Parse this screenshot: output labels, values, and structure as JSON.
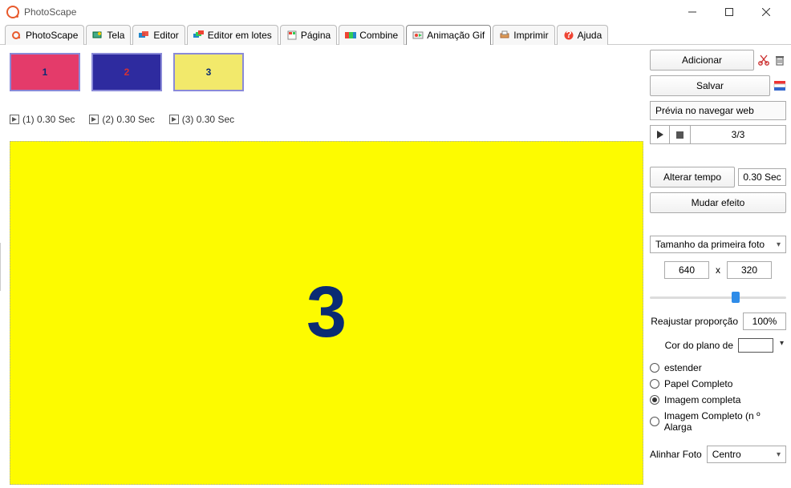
{
  "window": {
    "title": "PhotoScape"
  },
  "tabs": [
    {
      "label": "PhotoScape"
    },
    {
      "label": "Tela"
    },
    {
      "label": "Editor"
    },
    {
      "label": "Editor em lotes"
    },
    {
      "label": "Página"
    },
    {
      "label": "Combine"
    },
    {
      "label": "Animação Gif"
    },
    {
      "label": "Imprimir"
    },
    {
      "label": "Ajuda"
    }
  ],
  "frames": [
    {
      "num": "1",
      "timing": "(1) 0.30 Sec"
    },
    {
      "num": "2",
      "timing": "(2) 0.30 Sec"
    },
    {
      "num": "3",
      "timing": "(3) 0.30 Sec"
    }
  ],
  "preview": {
    "current_number": "3"
  },
  "panel": {
    "add": "Adicionar",
    "save": "Salvar",
    "preview_web": "Prévia no navegar web",
    "frame_counter": "3/3",
    "change_time": "Alterar tempo",
    "time_value": "0.30 Sec",
    "change_effect": "Mudar efeito",
    "size_mode": "Tamanho da primeira foto",
    "width": "640",
    "height": "320",
    "resize_label": "Reajustar proporção",
    "resize_pct": "100%",
    "bgcolor_label": "Cor do plano de",
    "radios": {
      "extend": "estender",
      "full_paper": "Papel Completo",
      "full_image": "Imagem completa",
      "full_image_no": "Imagem Completo (n º Alarga"
    },
    "align_label": "Alinhar Foto",
    "align_value": "Centro",
    "x_sep": "x"
  }
}
